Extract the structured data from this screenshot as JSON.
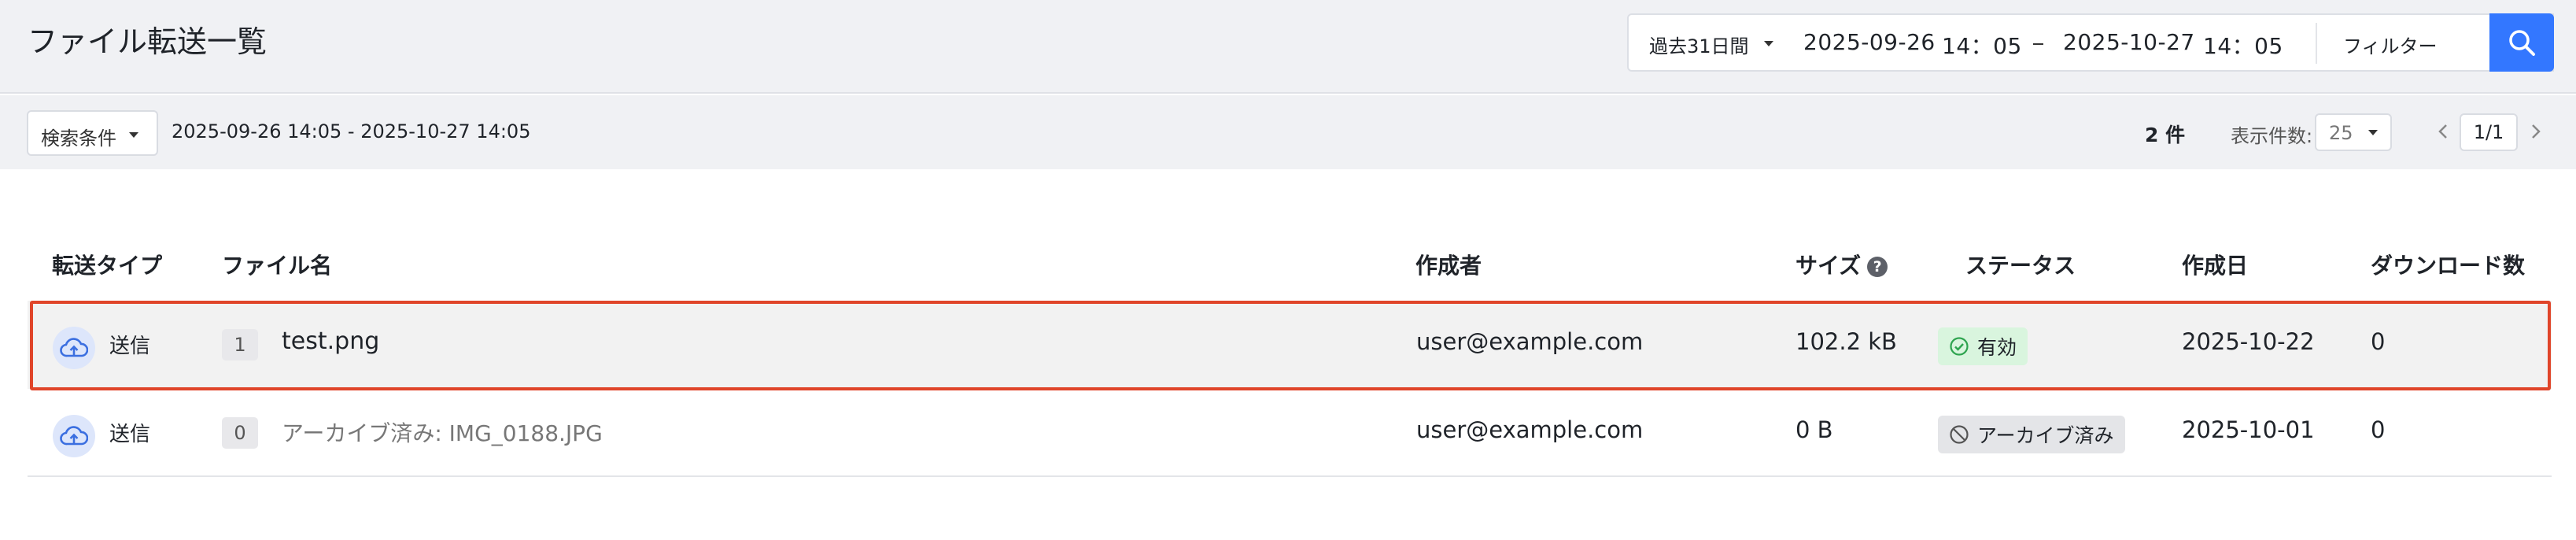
{
  "page": {
    "title": "ファイル転送一覧"
  },
  "date_filter": {
    "period": "過去31日間",
    "start_date": "2025-09-26",
    "start_time": "14：05",
    "end_date": "2025-10-27",
    "end_time": "14：05",
    "filter_label": "フィルター"
  },
  "toolbar": {
    "condition_label": "検索条件",
    "range_text": "2025-09-26 14:05 - 2025-10-27 14:05",
    "count": "2 件",
    "per_page_label": "表示件数:",
    "per_page_value": "25",
    "page_indicator": "1/1"
  },
  "table": {
    "headers": {
      "type": "転送タイプ",
      "filename": "ファイル名",
      "creator": "作成者",
      "size": "サイズ",
      "status": "ステータス",
      "created": "作成日",
      "downloads": "ダウンロード数"
    },
    "rows": [
      {
        "type": "送信",
        "version": "1",
        "filename": "test.png",
        "creator": "user@example.com",
        "size": "102.2 kB",
        "status": "有効",
        "created": "2025-10-22",
        "downloads": "0"
      },
      {
        "type": "送信",
        "version": "0",
        "filename": "アーカイブ済み: IMG_0188.JPG",
        "creator": "user@example.com",
        "size": "0 B",
        "status": "アーカイブ済み",
        "created": "2025-10-01",
        "downloads": "0"
      }
    ]
  },
  "colors": {
    "accent": "#3377ff",
    "selection_outline": "#e0452a",
    "status_active_bg": "#d9f5de",
    "status_active_icon": "#2ea44f",
    "upload_icon": "#3b6fe0"
  },
  "icons": [
    "search-icon",
    "filter-sliders-icon",
    "cloud-upload-icon",
    "check-circle-icon",
    "ban-icon",
    "help-icon",
    "chevron-left-icon",
    "chevron-right-icon",
    "caret-down-icon"
  ]
}
